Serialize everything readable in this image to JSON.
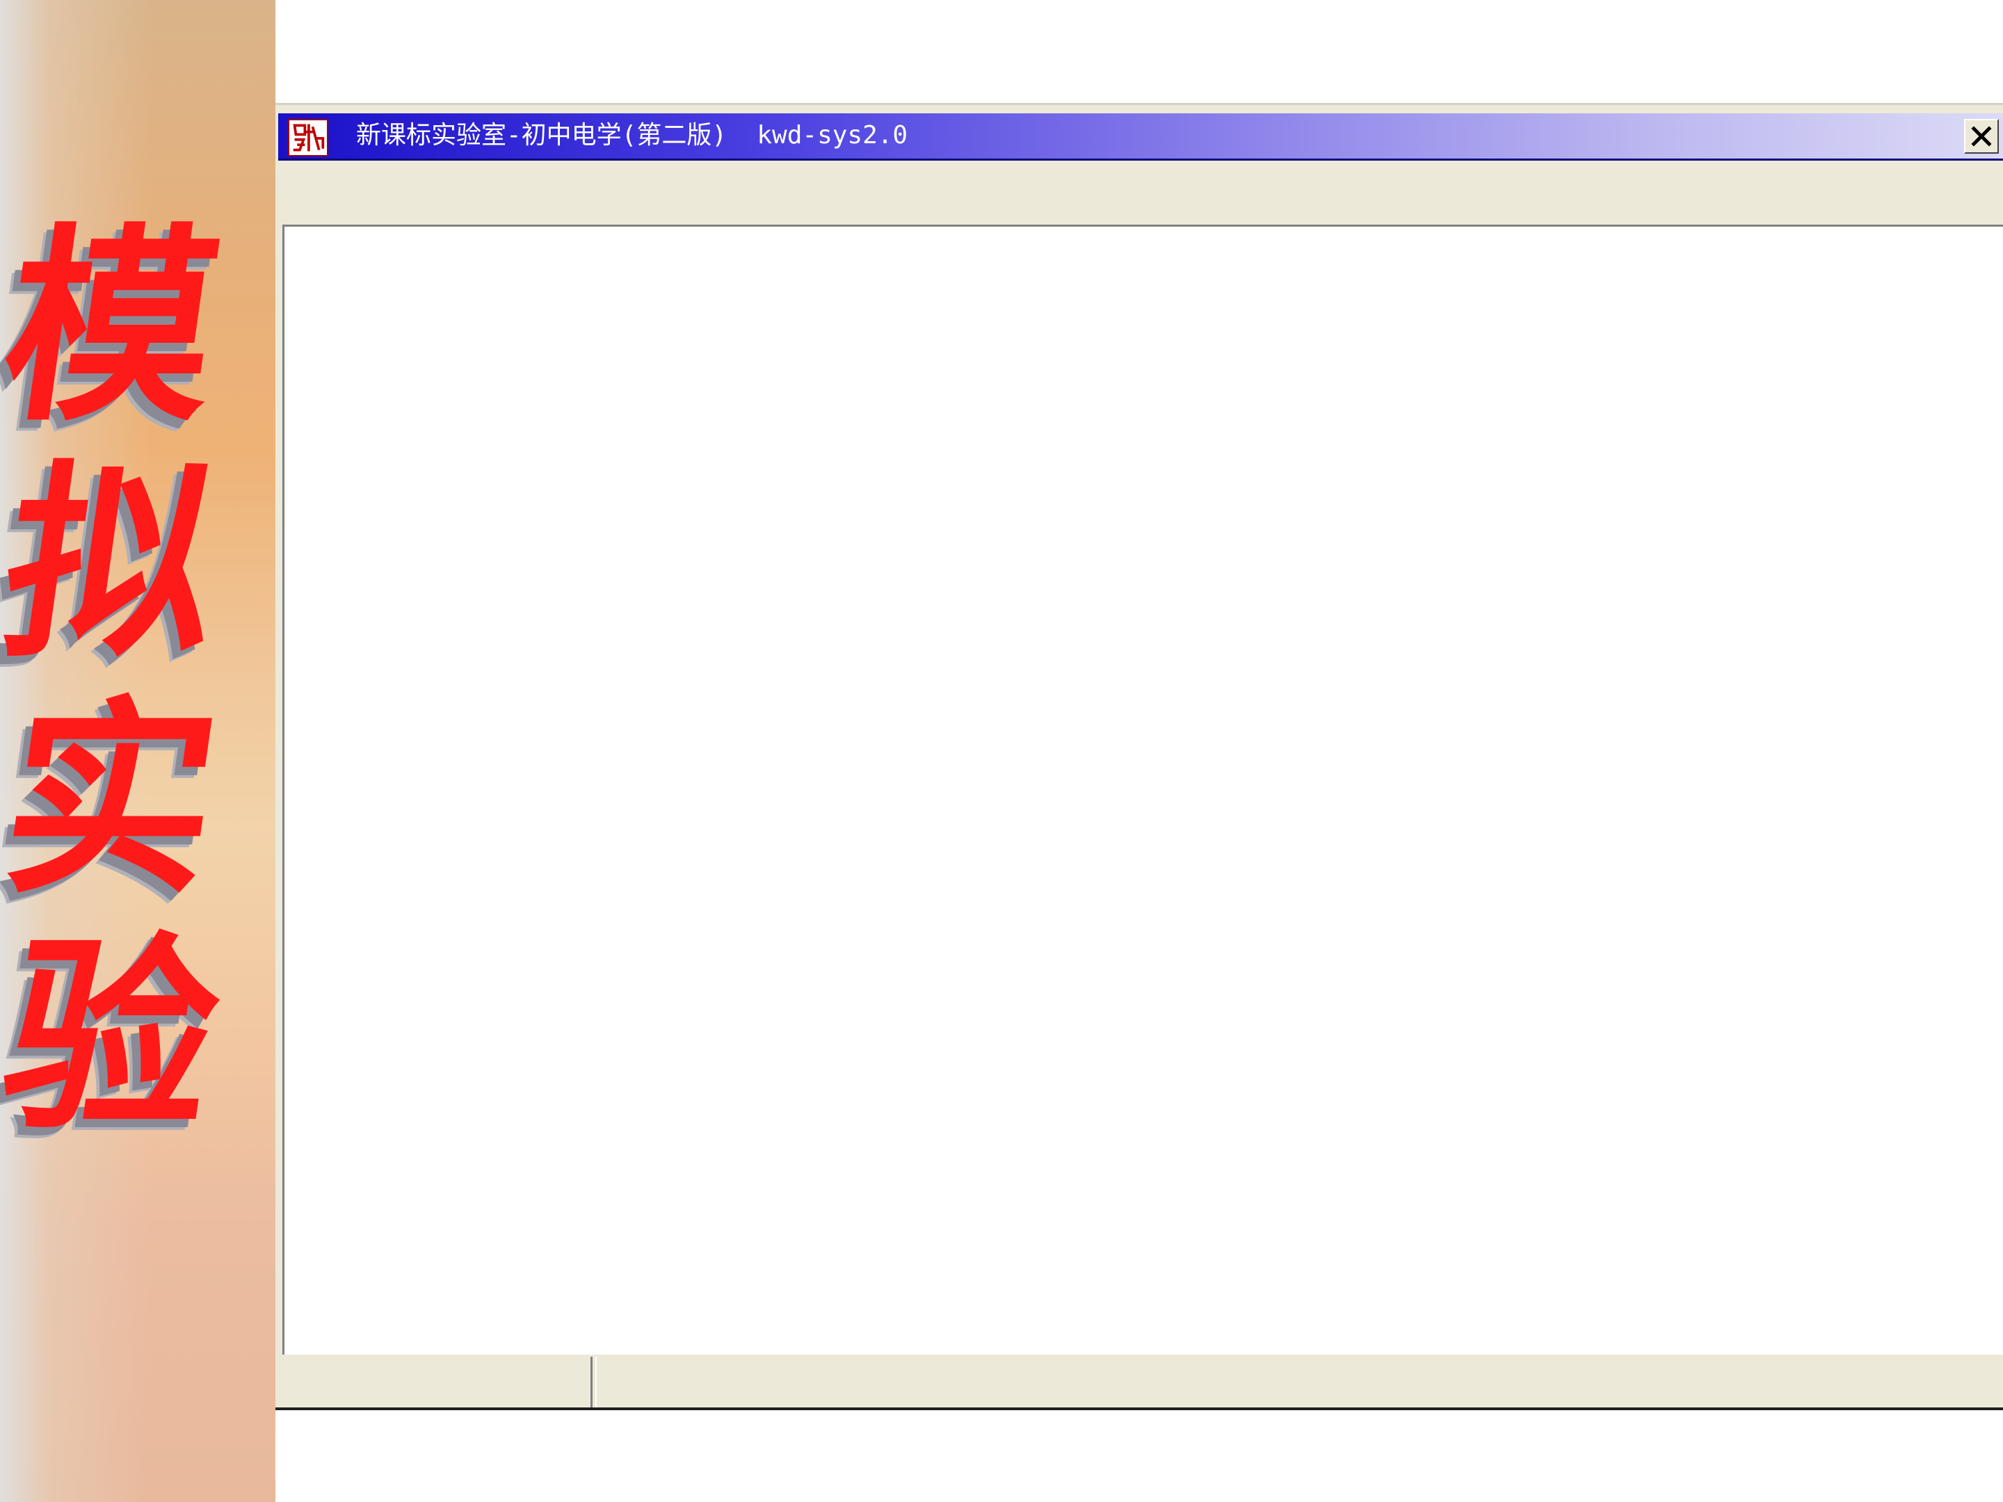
{
  "slide": {
    "title_chars": [
      "模",
      "拟",
      "实",
      "验"
    ]
  },
  "window": {
    "title": "新课标实验室-初中电学(第二版)  kwd-sys2.0",
    "icon": "app-logo-icon",
    "close_icon": "close-icon"
  },
  "status_bar": {
    "left_text": "",
    "right_text": ""
  },
  "colors": {
    "title_bar_start": "#1a10c8",
    "title_bar_end": "#dcdaf6",
    "window_face": "#ece9d8",
    "slide_title_red": "#ff1a1a"
  }
}
